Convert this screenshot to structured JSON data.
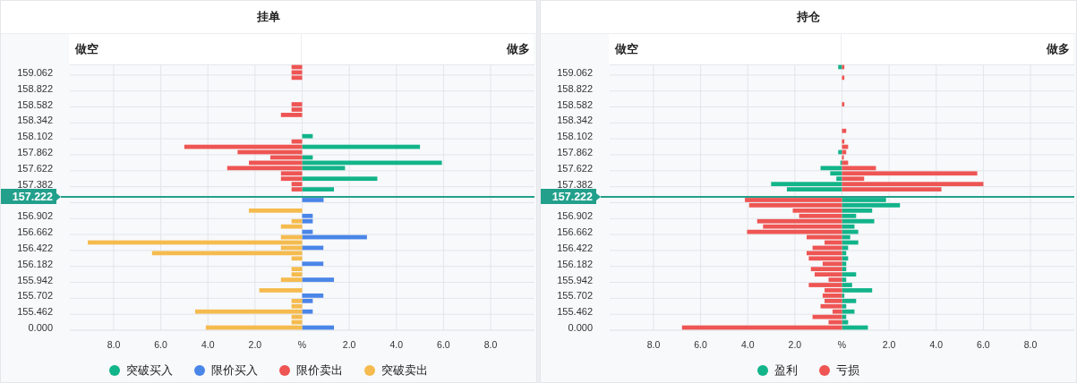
{
  "panels": [
    {
      "title": "挂单",
      "left_label": "做空",
      "right_label": "做多",
      "current_price": "157.222",
      "chart_data": {
        "type": "bar",
        "orientation": "horizontal",
        "stacked": true,
        "grid": true,
        "xlim": [
          -9.86,
          9.86
        ],
        "xticks": [
          {
            "value": -8,
            "label": "8.0"
          },
          {
            "value": -6,
            "label": "6.0"
          },
          {
            "value": -4,
            "label": "4.0"
          },
          {
            "value": -2,
            "label": "2.0"
          },
          {
            "value": 0,
            "label": "%"
          },
          {
            "value": 2,
            "label": "2.0"
          },
          {
            "value": 4,
            "label": "4.0"
          },
          {
            "value": 6,
            "label": "6.0"
          },
          {
            "value": 8,
            "label": "8.0"
          }
        ],
        "categories": [
          null,
          "159.062",
          null,
          null,
          "158.822",
          null,
          null,
          "158.582",
          null,
          null,
          "158.342",
          null,
          null,
          "158.102",
          null,
          null,
          "157.862",
          null,
          null,
          "157.622",
          null,
          null,
          "157.382",
          null,
          null,
          null,
          null,
          null,
          "156.902",
          null,
          null,
          "156.662",
          null,
          null,
          "156.422",
          null,
          null,
          "156.182",
          null,
          null,
          "155.942",
          null,
          null,
          "155.702",
          null,
          null,
          "155.462",
          null,
          null,
          "0.000"
        ],
        "series": [
          {
            "name": "突破买入",
            "color": "#12b48a",
            "values": [
              null,
              null,
              null,
              null,
              null,
              null,
              null,
              null,
              null,
              null,
              null,
              null,
              null,
              0.45,
              null,
              5.0,
              null,
              0.45,
              5.93,
              1.82,
              null,
              3.19,
              null,
              1.35,
              null,
              null,
              null,
              null,
              null,
              null,
              null,
              null,
              null,
              null,
              null,
              null,
              null,
              null,
              null,
              null,
              null,
              null,
              null,
              null,
              null,
              null,
              null,
              null,
              null,
              null
            ]
          },
          {
            "name": "限价买入",
            "color": "#4a85e8",
            "values": [
              null,
              null,
              null,
              null,
              null,
              null,
              null,
              null,
              null,
              null,
              null,
              null,
              null,
              null,
              null,
              null,
              null,
              null,
              null,
              null,
              null,
              null,
              null,
              null,
              null,
              0.91,
              null,
              null,
              0.45,
              0.45,
              null,
              0.45,
              2.75,
              null,
              0.9,
              null,
              null,
              0.9,
              null,
              null,
              1.35,
              null,
              null,
              0.9,
              0.45,
              null,
              0.45,
              null,
              null,
              1.35
            ]
          },
          {
            "name": "限价卖出",
            "color": "#ee5553",
            "values": [
              -0.45,
              -0.45,
              -0.45,
              null,
              null,
              null,
              null,
              -0.45,
              -0.45,
              -0.9,
              null,
              null,
              null,
              null,
              -0.45,
              -5.0,
              -2.74,
              -1.35,
              -2.26,
              -3.18,
              -0.9,
              -0.9,
              -0.45,
              -0.45,
              null,
              null,
              null,
              null,
              null,
              null,
              null,
              null,
              null,
              null,
              null,
              null,
              null,
              null,
              null,
              null,
              null,
              null,
              null,
              null,
              null,
              null,
              null,
              null,
              null,
              null
            ]
          },
          {
            "name": "突破卖出",
            "color": "#f5bb4e",
            "values": [
              null,
              null,
              null,
              null,
              null,
              null,
              null,
              null,
              null,
              null,
              null,
              null,
              null,
              null,
              null,
              null,
              null,
              null,
              null,
              null,
              null,
              null,
              null,
              null,
              null,
              null,
              null,
              -2.26,
              null,
              -0.45,
              -0.9,
              null,
              -0.9,
              -9.1,
              -0.9,
              -6.37,
              -0.45,
              null,
              -0.45,
              -0.45,
              -0.9,
              null,
              -1.82,
              null,
              -0.45,
              -0.45,
              -4.54,
              -0.45,
              -0.45,
              -4.09
            ]
          }
        ]
      }
    },
    {
      "title": "持仓",
      "left_label": "做空",
      "right_label": "做多",
      "current_price": "157.222",
      "chart_data": {
        "type": "bar",
        "orientation": "horizontal",
        "stacked": true,
        "grid": true,
        "xlim": [
          -9.86,
          9.86
        ],
        "xticks": [
          {
            "value": -8,
            "label": "8.0"
          },
          {
            "value": -6,
            "label": "6.0"
          },
          {
            "value": -4,
            "label": "4.0"
          },
          {
            "value": -2,
            "label": "2.0"
          },
          {
            "value": 0,
            "label": "%"
          },
          {
            "value": 2,
            "label": "2.0"
          },
          {
            "value": 4,
            "label": "4.0"
          },
          {
            "value": 6,
            "label": "6.0"
          },
          {
            "value": 8,
            "label": "8.0"
          }
        ],
        "categories": [
          null,
          "159.062",
          null,
          null,
          "158.822",
          null,
          null,
          "158.582",
          null,
          null,
          "158.342",
          null,
          null,
          "158.102",
          null,
          null,
          "157.862",
          null,
          null,
          "157.622",
          null,
          null,
          "157.382",
          null,
          null,
          null,
          null,
          null,
          "156.902",
          null,
          null,
          "156.662",
          null,
          null,
          "156.422",
          null,
          null,
          "156.182",
          null,
          null,
          "155.942",
          null,
          null,
          "155.702",
          null,
          null,
          "155.462",
          null,
          null,
          "0.000"
        ],
        "series": [
          {
            "name": "盈利",
            "color": "#12b48a",
            "values": [
              -0.16,
              null,
              null,
              null,
              null,
              null,
              null,
              null,
              null,
              null,
              null,
              null,
              null,
              null,
              null,
              null,
              -0.16,
              null,
              -0.07,
              -0.91,
              -0.5,
              -0.24,
              -3.01,
              -2.34,
              null,
              1.87,
              2.46,
              1.28,
              0.6,
              1.37,
              0.53,
              0.69,
              0.35,
              0.69,
              0.26,
              0.18,
              0.26,
              0.18,
              0.18,
              0.6,
              0.18,
              0.43,
              1.28,
              0.1,
              0.6,
              0.18,
              0.53,
              0.18,
              0.26,
              1.1
            ]
          },
          {
            "name": "亏损",
            "color": "#ee5553",
            "values": [
              0.1,
              null,
              0.1,
              null,
              null,
              null,
              null,
              0.1,
              null,
              null,
              null,
              null,
              0.18,
              null,
              0.1,
              0.26,
              0.18,
              0.07,
              0.26,
              1.44,
              5.74,
              0.94,
              6.0,
              4.22,
              null,
              -4.12,
              -3.94,
              -2.09,
              -1.82,
              -3.6,
              -3.35,
              -4.03,
              -1.5,
              -0.74,
              -1.25,
              -1.5,
              -1.41,
              -0.82,
              -1.32,
              -1.16,
              -0.57,
              -1.41,
              -0.74,
              -0.82,
              -0.74,
              -0.91,
              -0.4,
              -1.25,
              -0.57,
              -6.79
            ]
          }
        ]
      }
    }
  ]
}
